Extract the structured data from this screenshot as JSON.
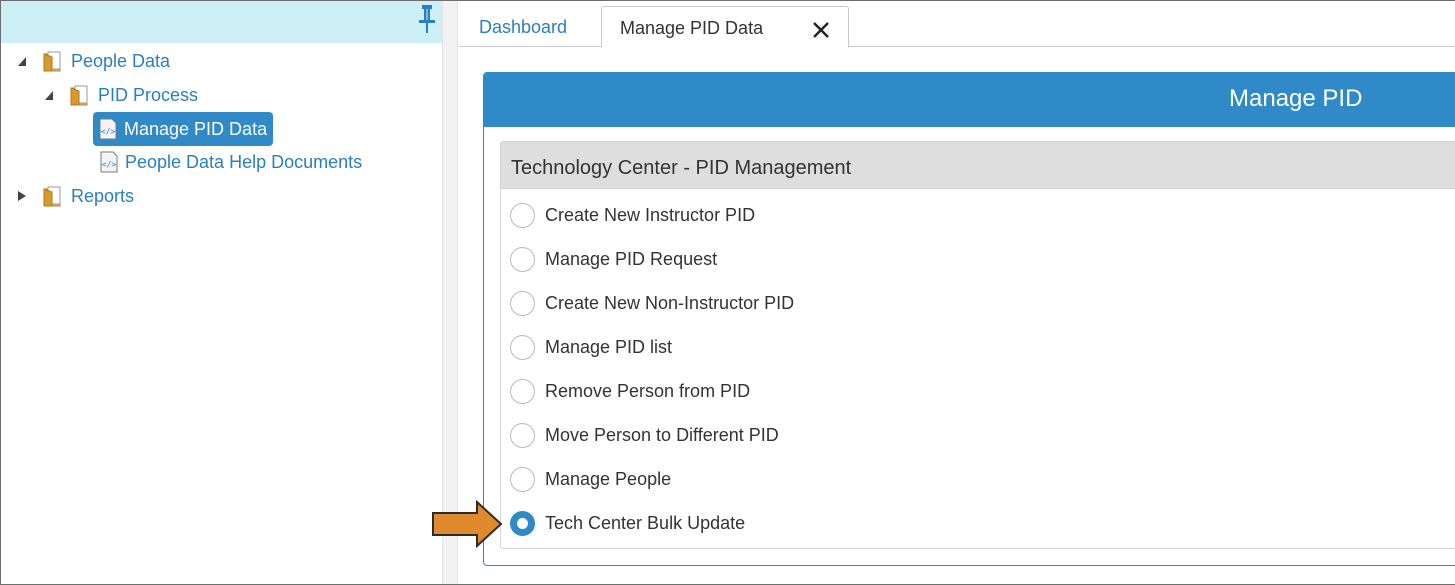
{
  "tree": {
    "items": [
      {
        "label": "People Data"
      },
      {
        "label": "PID Process"
      },
      {
        "label": "Manage PID Data"
      },
      {
        "label": "People Data Help Documents"
      },
      {
        "label": "Reports"
      }
    ]
  },
  "tabs": [
    {
      "label": "Dashboard"
    },
    {
      "label": "Manage PID Data"
    }
  ],
  "panel": {
    "title": "Manage PID",
    "group_title": "Technology Center - PID Management",
    "options": [
      {
        "label": "Create New Instructor PID",
        "checked": false
      },
      {
        "label": "Manage PID Request",
        "checked": false
      },
      {
        "label": "Create New Non-Instructor PID",
        "checked": false
      },
      {
        "label": "Manage PID list",
        "checked": false
      },
      {
        "label": "Remove Person from PID",
        "checked": false
      },
      {
        "label": "Move Person to Different PID",
        "checked": false
      },
      {
        "label": "Manage People",
        "checked": false
      },
      {
        "label": "Tech Center Bulk Update",
        "checked": true
      }
    ]
  },
  "colors": {
    "accent": "#2f8ac7",
    "link": "#2a7fc1",
    "sidebar_top": "#cdeff6",
    "group_header": "#dedede",
    "annotation_arrow": "#e08a2e"
  },
  "icons": [
    "pin-icon",
    "expand-arrow-icon",
    "collapse-arrow-icon",
    "folder-icon",
    "page-icon",
    "close-icon",
    "pointer-arrow-icon"
  ]
}
